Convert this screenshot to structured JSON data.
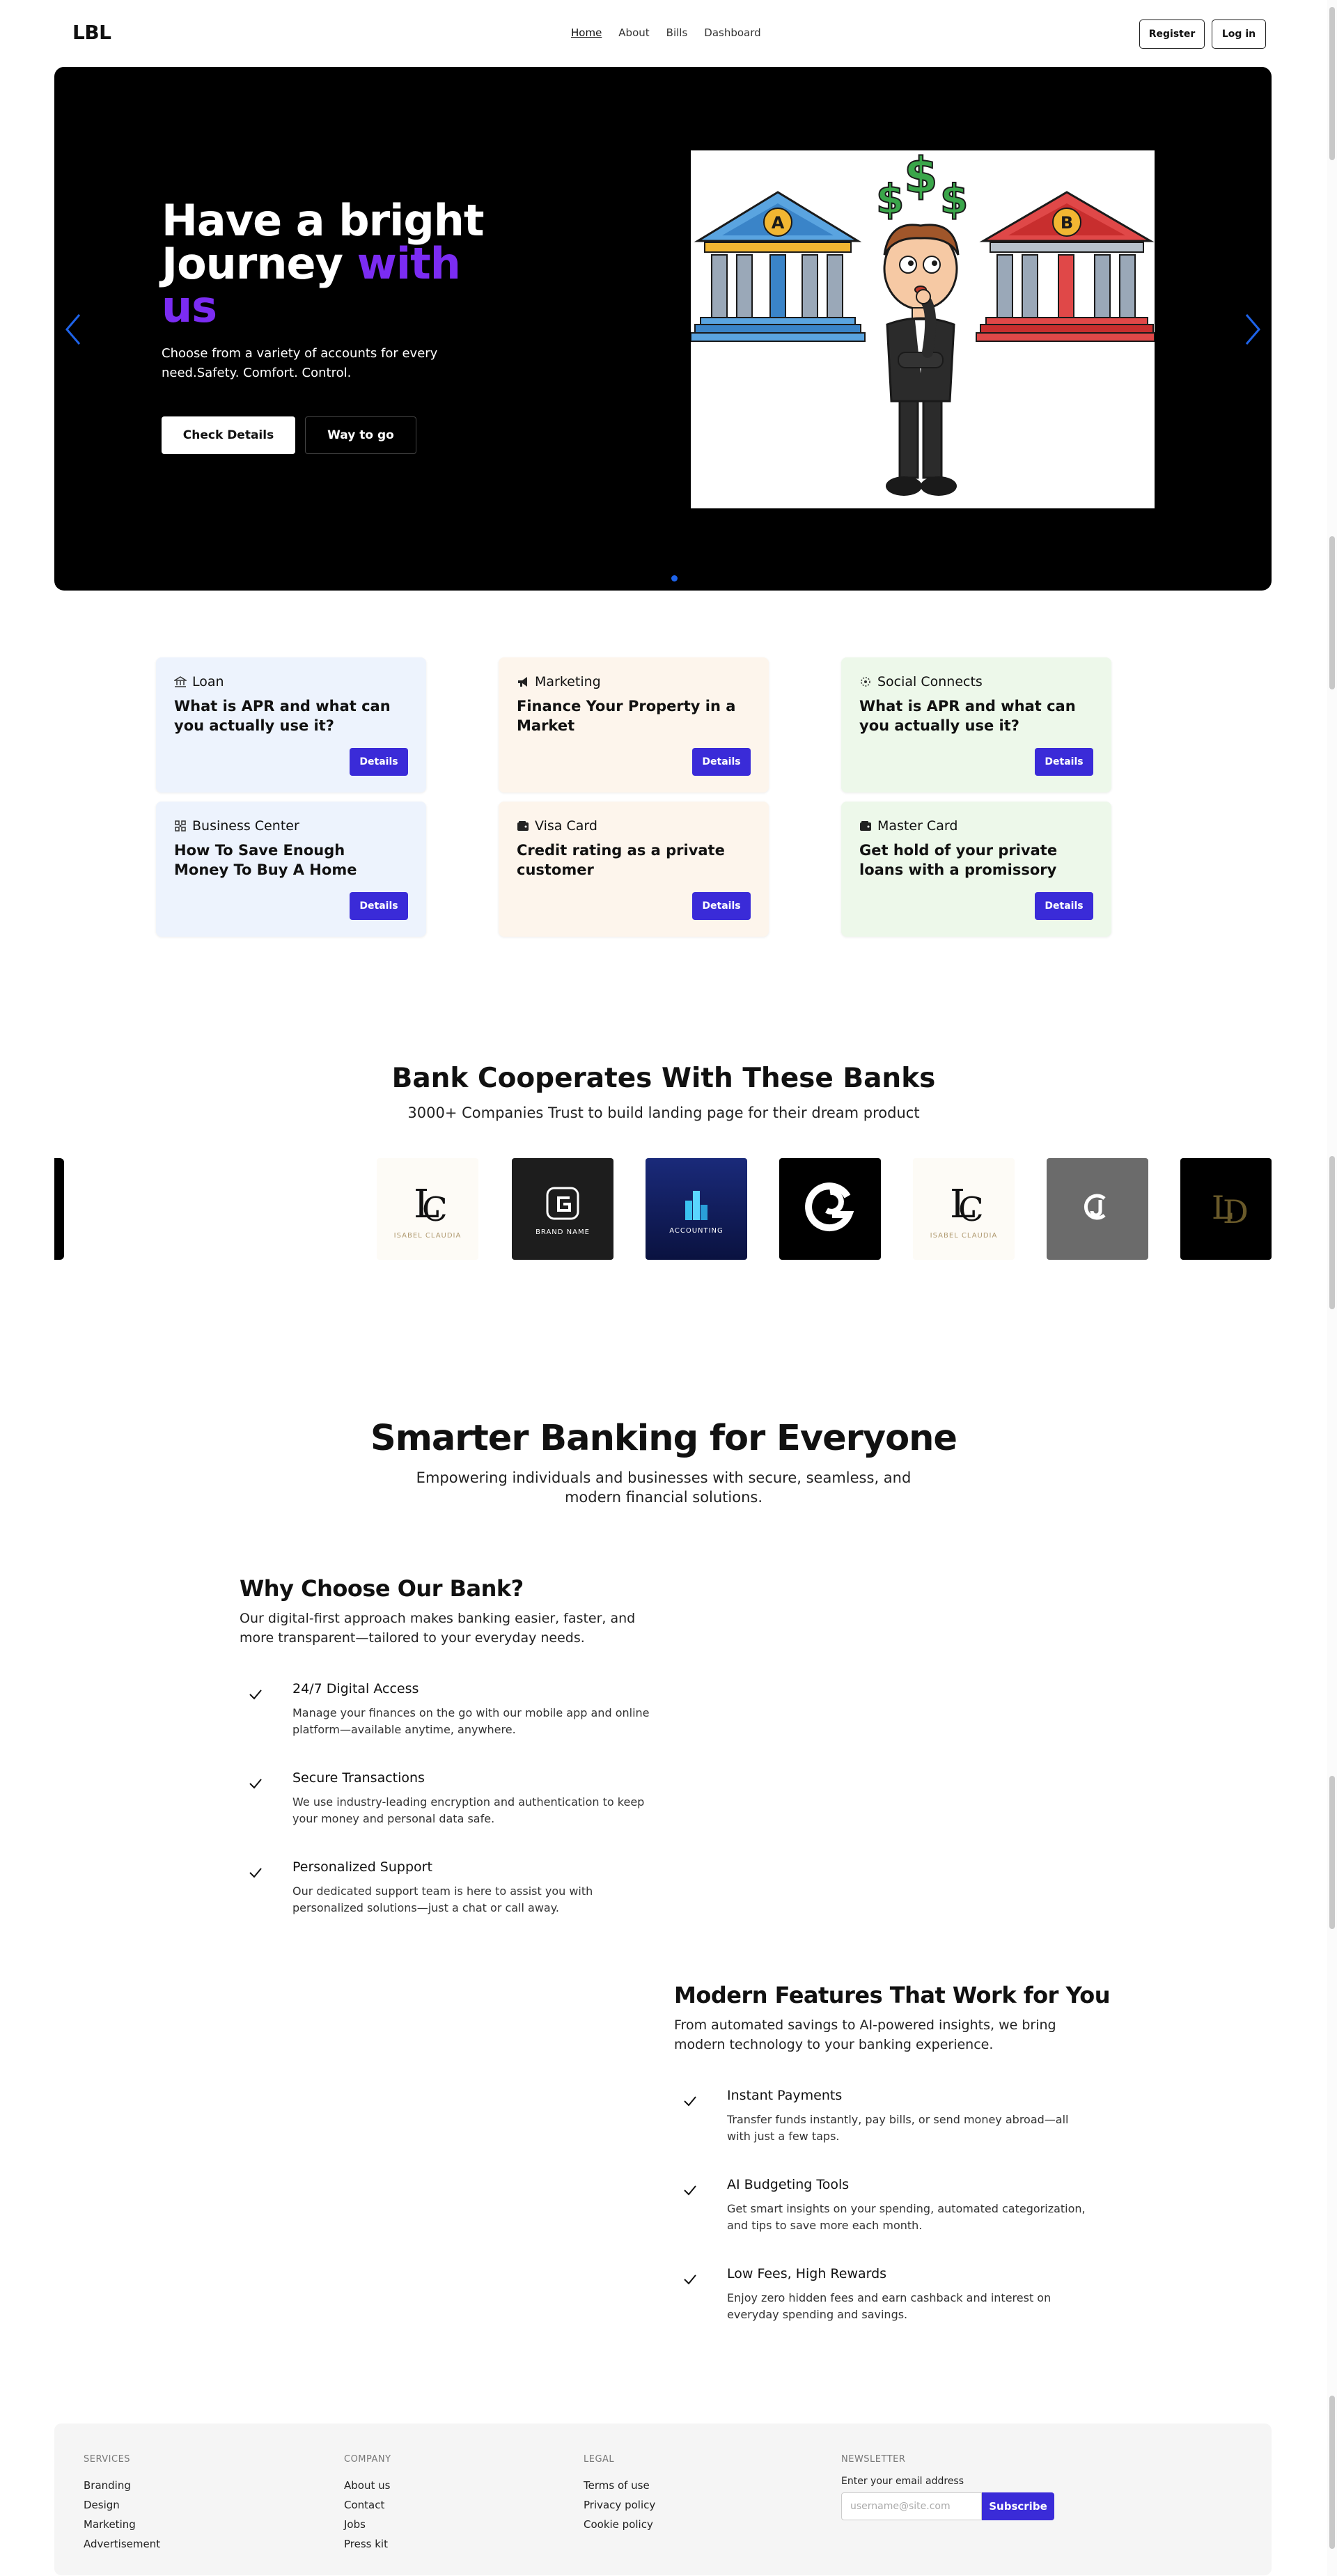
{
  "nav": {
    "logo": "LBL",
    "links": [
      "Home",
      "About",
      "Bills",
      "Dashboard"
    ],
    "register_label": "Register",
    "login_label": "Log in"
  },
  "hero": {
    "title_line1": "Have a bright",
    "title_line2a": "Journey ",
    "title_line2b": "with",
    "title_line3": "us",
    "subtitle": "Choose from a variety of accounts for every need.Safety. Comfort. Control.",
    "primary_button": "Check Details",
    "secondary_button": "Way to go",
    "illustration": {
      "bank_a_label": "A",
      "bank_b_label": "B"
    },
    "accent_color": "#7b2cf2"
  },
  "cards": [
    {
      "tag": "Loan",
      "title": "What is APR and what can you actually use it?",
      "button": "Details",
      "icon": "bank-icon"
    },
    {
      "tag": "Marketing",
      "title": "Finance Your Property in a Market",
      "button": "Details",
      "icon": "megaphone-icon"
    },
    {
      "tag": "Social Connects",
      "title": "What is APR and what can you actually use it?",
      "button": "Details",
      "icon": "network-icon"
    },
    {
      "tag": "Business Center",
      "title": "How To Save Enough Money To Buy A Home",
      "button": "Details",
      "icon": "business-icon"
    },
    {
      "tag": "Visa Card",
      "title": "Credit rating as a private customer",
      "button": "Details",
      "icon": "wallet-icon"
    },
    {
      "tag": "Master Card",
      "title": "Get hold of your private loans with a promissory",
      "button": "Details",
      "icon": "wallet-icon"
    }
  ],
  "banks": {
    "title": "Bank Cooperates With These Banks",
    "subtitle": "3000+ Companies Trust to build landing page for their dream product",
    "logos": [
      {
        "caption": "ISABEL CLAUDIA"
      },
      {
        "caption": "BRAND NAME"
      },
      {
        "caption": "ACCOUNTING"
      },
      {
        "caption": ""
      },
      {
        "caption": "ISABEL CLAUDIA"
      },
      {
        "caption": ""
      },
      {
        "caption": ""
      }
    ]
  },
  "smarter": {
    "title": "Smarter Banking for Everyone",
    "subtitle": "Empowering individuals and businesses with secure, seamless, and modern financial solutions."
  },
  "why": {
    "title": "Why Choose Our Bank?",
    "text": "Our digital-first approach makes banking easier, faster, and more transparent—tailored to your everyday needs.",
    "items": [
      {
        "title": "24/7 Digital Access",
        "desc": "Manage your finances on the go with our mobile app and online platform—available anytime, anywhere."
      },
      {
        "title": "Secure Transactions",
        "desc": "We use industry-leading encryption and authentication to keep your money and personal data safe."
      },
      {
        "title": "Personalized Support",
        "desc": "Our dedicated support team is here to assist you with personalized solutions—just a chat or call away."
      }
    ]
  },
  "modern": {
    "title": "Modern Features That Work for You",
    "text": "From automated savings to AI-powered insights, we bring modern technology to your banking experience.",
    "items": [
      {
        "title": "Instant Payments",
        "desc": "Transfer funds instantly, pay bills, or send money abroad—all with just a few taps."
      },
      {
        "title": "AI Budgeting Tools",
        "desc": "Get smart insights on your spending, automated categorization, and tips to save more each month."
      },
      {
        "title": "Low Fees, High Rewards",
        "desc": "Enjoy zero hidden fees and earn cashback and interest on everyday spending and savings."
      }
    ]
  },
  "footer": {
    "services": {
      "heading": "SERVICES",
      "links": [
        "Branding",
        "Design",
        "Marketing",
        "Advertisement"
      ]
    },
    "company": {
      "heading": "COMPANY",
      "links": [
        "About us",
        "Contact",
        "Jobs",
        "Press kit"
      ]
    },
    "legal": {
      "heading": "LEGAL",
      "links": [
        "Terms of use",
        "Privacy policy",
        "Cookie policy"
      ]
    },
    "newsletter": {
      "heading": "NEWSLETTER",
      "label": "Enter your email address",
      "placeholder": "username@site.com",
      "button": "Subscribe"
    }
  },
  "colors": {
    "primary_button": "#3a2bd8",
    "purple": "#7b2cf2",
    "arrow": "#1e63e9"
  }
}
